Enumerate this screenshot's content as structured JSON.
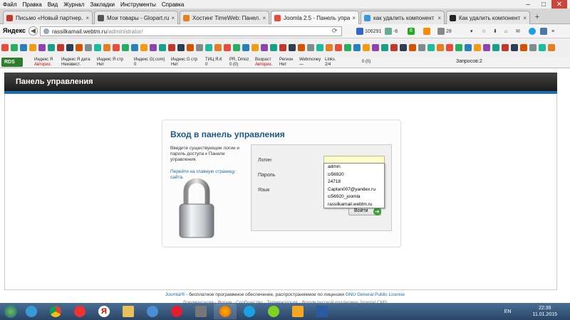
{
  "menubar": [
    "Файл",
    "Правка",
    "Вид",
    "Журнал",
    "Закладки",
    "Инструменты",
    "Справка"
  ],
  "tabs": [
    {
      "title": "Письмо «Новый партнер...",
      "color": "#c0392b"
    },
    {
      "title": "Мои товары - Glopart.ru",
      "color": "#555"
    },
    {
      "title": "Хостинг TimeWeb: Панел...",
      "color": "#e67e22"
    },
    {
      "title": "Joomla 2.5 - Панель управ...",
      "color": "#e74c3c"
    },
    {
      "title": "как удалить компонент н...",
      "color": "#3498db"
    },
    {
      "title": "Как удалить компонент в ...",
      "color": "#222"
    }
  ],
  "browser": {
    "brand": "Яндекс",
    "url_host": "rassilkamail.webtm.ru",
    "url_path": "/administrator/",
    "counter": "106291",
    "val1": "-6",
    "badge": "6",
    "count": "28"
  },
  "seo": [
    {
      "l1": "Индекс Я",
      "l2": "Авториз.",
      "red": true
    },
    {
      "l1": "Индекс Я дата",
      "l2": "Неизвест."
    },
    {
      "l1": "Индекс Я стр",
      "l2": "Нет"
    },
    {
      "l1": "Индекс G(.com)",
      "l2": "0"
    },
    {
      "l1": "Индекс G стр",
      "l2": "Нет"
    },
    {
      "l1": "ТИЦ Я.К",
      "l2": "0"
    },
    {
      "l1": "PR, Dmoz",
      "l2": "0 (0)"
    },
    {
      "l1": "Возраст",
      "l2": "Авториз.",
      "red": true
    },
    {
      "l1": "Регион",
      "l2": "Нет"
    },
    {
      "l1": "Webmoney",
      "l2": "—"
    },
    {
      "l1": "Links",
      "l2": "2/4"
    }
  ],
  "seo_extra": "0 (0)",
  "zaprosy": "Запросов:2",
  "page": {
    "header_title": "Панель управления",
    "login_title": "Вход в панель управления",
    "intro": "Введите существующие логин и пароль доступа к Панели управления.",
    "home_link": "Перейти на главную страницу сайта.",
    "label_login": "Логин",
    "label_password": "Пароль",
    "label_lang": "Язык",
    "login_button": "Войти",
    "autocomplete": [
      "admin",
      "ci56920",
      "24718",
      "Captan007@yandex.ru",
      "ci56920_joomla",
      "rassilkamail.webtm.ru"
    ]
  },
  "footer": {
    "pre": "Joomla!®",
    "text": " - бесплатное программное обеспечение, распространяемое по лицензии ",
    "link": "GNU General Public License"
  },
  "footer2": "Документация · Форум · Сообщество · Терминология · Форум русской поддержки Joomla! CMS",
  "taskbar": {
    "lang": "EN",
    "time": "22:39",
    "date": "11.01.2015"
  }
}
